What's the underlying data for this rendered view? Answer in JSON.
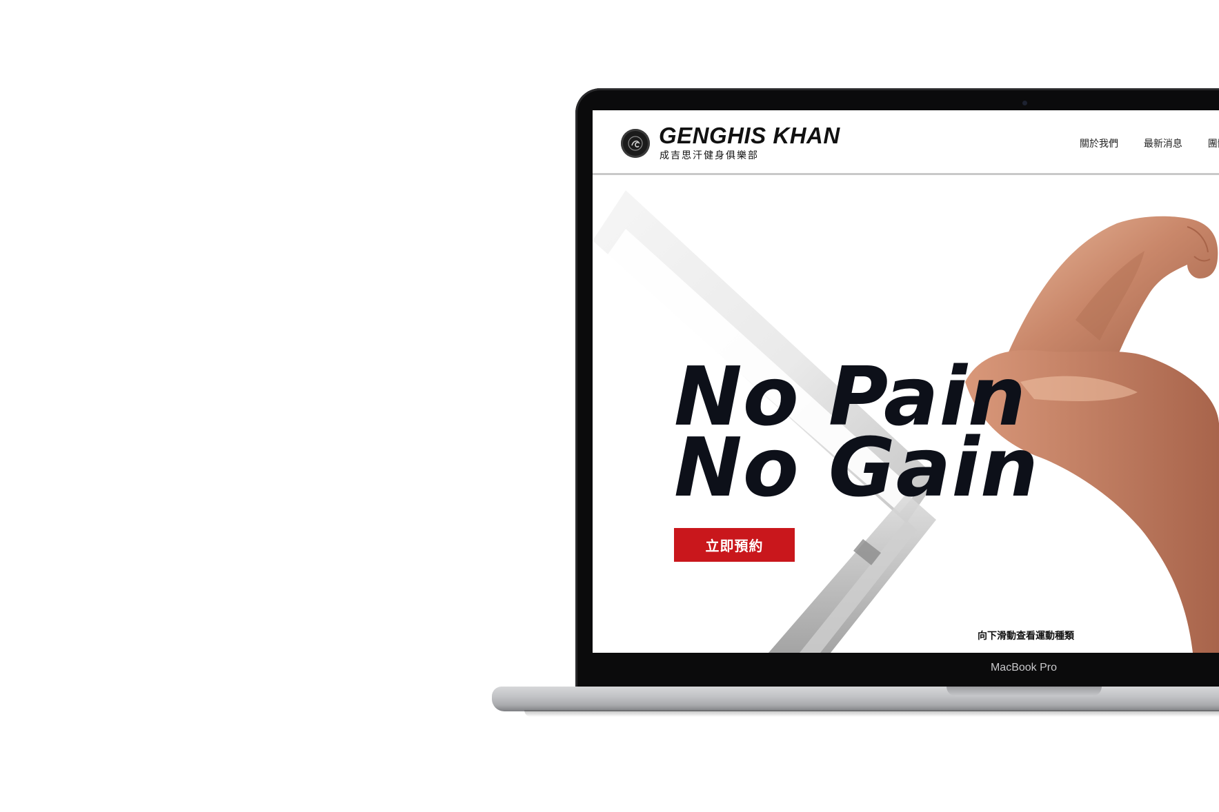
{
  "device": {
    "model_label": "MacBook Pro"
  },
  "header": {
    "logo_title": "GENGHIS KHAN",
    "logo_subtitle": "成吉思汗健身俱樂部",
    "nav": [
      {
        "label": "關於我們"
      },
      {
        "label": "最新消息"
      },
      {
        "label": "團體"
      }
    ]
  },
  "hero": {
    "headline_line1": "No Pain",
    "headline_line2": "No Gain",
    "cta_label": "立即預約",
    "scroll_hint": "向下滑動查看運動種類"
  },
  "colors": {
    "accent_red": "#c9171c",
    "headline_dark": "#0d1019",
    "bezel": "#0b0b0c"
  },
  "icons": {
    "logo": "genghis-khan-emblem-icon"
  }
}
